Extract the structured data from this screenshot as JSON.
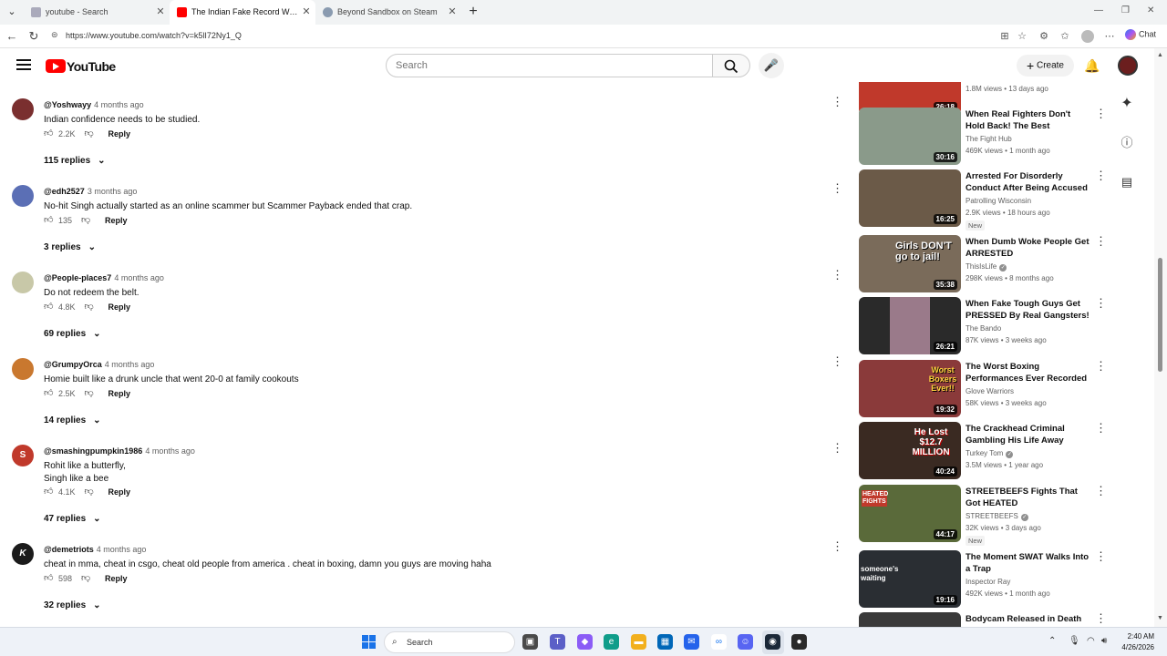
{
  "browser": {
    "tabs": [
      {
        "label": "youtube - Search",
        "active": false
      },
      {
        "label": "The Indian Fake Record World Ch",
        "active": true
      },
      {
        "label": "Beyond Sandbox on Steam",
        "active": false
      }
    ],
    "url": "https://www.youtube.com/watch?v=k5lI72Ny1_Q",
    "chat_label": "Chat"
  },
  "youtube": {
    "logo_text": "YouTube",
    "search_placeholder": "Search",
    "create_label": "Create"
  },
  "comments": [
    {
      "author": "@Yoshwayy",
      "time": "4 months ago",
      "text": "Indian confidence needs to be studied.",
      "likes": "2.2K",
      "reply_label": "Reply",
      "replies": "115 replies",
      "avatar_color": "#7a2f2f",
      "avatar_letter": ""
    },
    {
      "author": "@edh2527",
      "time": "3 months ago",
      "text": "No-hit Singh actually started as an online scammer but Scammer Payback ended that crap.",
      "likes": "135",
      "reply_label": "Reply",
      "replies": "3 replies",
      "avatar_color": "#5b6fb5",
      "avatar_letter": ""
    },
    {
      "author": "@People-places7",
      "time": "4 months ago",
      "text": "Do not redeem the belt.",
      "likes": "4.8K",
      "reply_label": "Reply",
      "replies": "69 replies",
      "avatar_color": "#c8c8a8",
      "avatar_letter": ""
    },
    {
      "author": "@GrumpyOrca",
      "time": "4 months ago",
      "text": "Homie built like a drunk uncle that went 20-0 at family cookouts",
      "likes": "2.5K",
      "reply_label": "Reply",
      "replies": "14 replies",
      "avatar_color": "#c9782f",
      "avatar_letter": ""
    },
    {
      "author": "@smashingpumpkin1986",
      "time": "4 months ago",
      "text": "Rohit like a butterfly,\nSingh like a bee",
      "likes": "4.1K",
      "reply_label": "Reply",
      "replies": "47 replies",
      "avatar_color": "#c0392b",
      "avatar_letter": "S"
    },
    {
      "author": "@demetriots",
      "time": "4 months ago",
      "text": "cheat in mma, cheat in csgo, cheat old people from america . cheat in boxing, damn you guys are moving haha",
      "likes": "598",
      "reply_label": "Reply",
      "replies": "32 replies",
      "avatar_color": "#1b1b1b",
      "avatar_letter": "K"
    }
  ],
  "videos": [
    {
      "title": "",
      "channel": "",
      "verified": false,
      "views": "1.8M views",
      "age": "13 days ago",
      "duration": "26:18",
      "badge": "",
      "thumb_color": "#c0392b"
    },
    {
      "title": "When Real Fighters Don't Hold Back! The Best Compilation",
      "channel": "The Fight Hub",
      "verified": false,
      "views": "469K views",
      "age": "1 month ago",
      "duration": "30:16",
      "badge": "",
      "thumb_color": "#8a9a8a"
    },
    {
      "title": "Arrested For Disorderly Conduct After Being Accused Of Stealing",
      "channel": "Patrolling Wisconsin",
      "verified": false,
      "views": "2.9K views",
      "age": "18 hours ago",
      "duration": "16:25",
      "badge": "New",
      "thumb_color": "#6b5a48"
    },
    {
      "title": "When Dumb Woke People Get ARRESTED",
      "channel": "ThisIsLife",
      "verified": true,
      "views": "298K views",
      "age": "8 months ago",
      "duration": "35:38",
      "badge": "",
      "thumb_color": "#7a6b5a",
      "thumb_text": "Girls DON'T go to jail!"
    },
    {
      "title": "When Fake Tough Guys Get PRESSED By Real Gangsters!",
      "channel": "The Bando",
      "verified": false,
      "views": "87K views",
      "age": "3 weeks ago",
      "duration": "26:21",
      "badge": "",
      "thumb_color": "#2a2a2a"
    },
    {
      "title": "The Worst Boxing Performances Ever Recorded |...",
      "channel": "Glove Warriors",
      "verified": false,
      "views": "58K views",
      "age": "3 weeks ago",
      "duration": "19:32",
      "badge": "",
      "thumb_color": "#8a3a3a",
      "thumb_text": "Worst Boxers Ever!!"
    },
    {
      "title": "The Crackhead Criminal Gambling His Life Away",
      "channel": "Turkey Tom",
      "verified": true,
      "views": "3.5M views",
      "age": "1 year ago",
      "duration": "40:24",
      "badge": "",
      "thumb_color": "#3a2a22",
      "thumb_text": "He Lost $12.7 MILLION"
    },
    {
      "title": "STREETBEEFS Fights That Got HEATED",
      "channel": "STREETBEEFS",
      "verified": true,
      "views": "32K views",
      "age": "3 days ago",
      "duration": "44:17",
      "badge": "New",
      "thumb_color": "#5a6a3a",
      "thumb_text": "HEATED FIGHTS"
    },
    {
      "title": "The Moment SWAT Walks Into a Trap",
      "channel": "Inspector Ray",
      "verified": false,
      "views": "492K views",
      "age": "1 month ago",
      "duration": "19:16",
      "badge": "",
      "thumb_color": "#2a2e33",
      "thumb_text": "someone's waiting"
    },
    {
      "title": "Bodycam Released in Death of",
      "channel": "",
      "verified": false,
      "views": "",
      "age": "",
      "duration": "",
      "badge": "",
      "thumb_color": "#3a3a3a"
    }
  ],
  "taskbar": {
    "search_label": "Search",
    "time": "2:40 AM",
    "date": "4/26/2026"
  }
}
